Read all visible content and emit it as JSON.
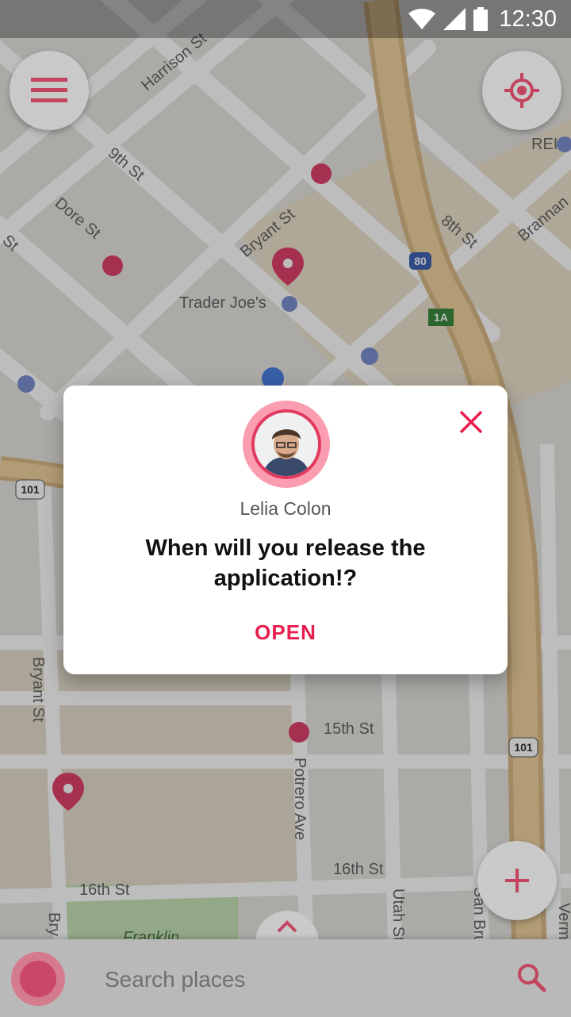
{
  "status_bar": {
    "time": "12:30"
  },
  "map": {
    "streets": [
      "Harrison St",
      "9th St",
      "Dore St",
      "Bryant St",
      "8th St",
      "Brannan",
      "Bryant St",
      "15th St",
      "Potrero Ave",
      "16th St",
      "16th St",
      "Utah St",
      "San Bru",
      "Verm",
      "Bry",
      "St"
    ],
    "places": [
      "Trader Joe's",
      "REI",
      "Franklin"
    ],
    "highway_shields": [
      "80",
      "1A",
      "101",
      "101"
    ]
  },
  "dialog": {
    "sender_name": "Lelia Colon",
    "message": "When will you release the application!?",
    "open_label": "OPEN"
  },
  "search": {
    "placeholder": "Search places"
  },
  "colors": {
    "accent": "#e91e4f",
    "dim_overlay": "rgba(0,0,0,0.26)",
    "dialog_bg": "#ffffff"
  },
  "icons": [
    "menu-icon",
    "locate-icon",
    "close-icon",
    "add-icon",
    "chevron-up-icon",
    "search-icon",
    "record-icon",
    "wifi-icon",
    "signal-icon",
    "battery-icon"
  ]
}
